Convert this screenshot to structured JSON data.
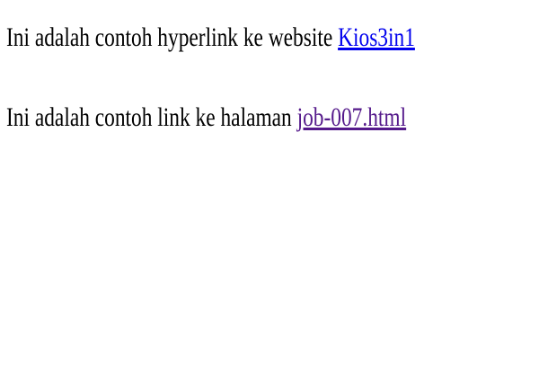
{
  "paragraphs": [
    {
      "text": "Ini adalah contoh hyperlink ke website ",
      "link": {
        "label": "Kios3in1",
        "state": "unvisited",
        "color": "#0000ee"
      }
    },
    {
      "text": "Ini adalah contoh link ke halaman ",
      "link": {
        "label": "job-007.html",
        "state": "visited",
        "color": "#551a8b"
      }
    }
  ]
}
